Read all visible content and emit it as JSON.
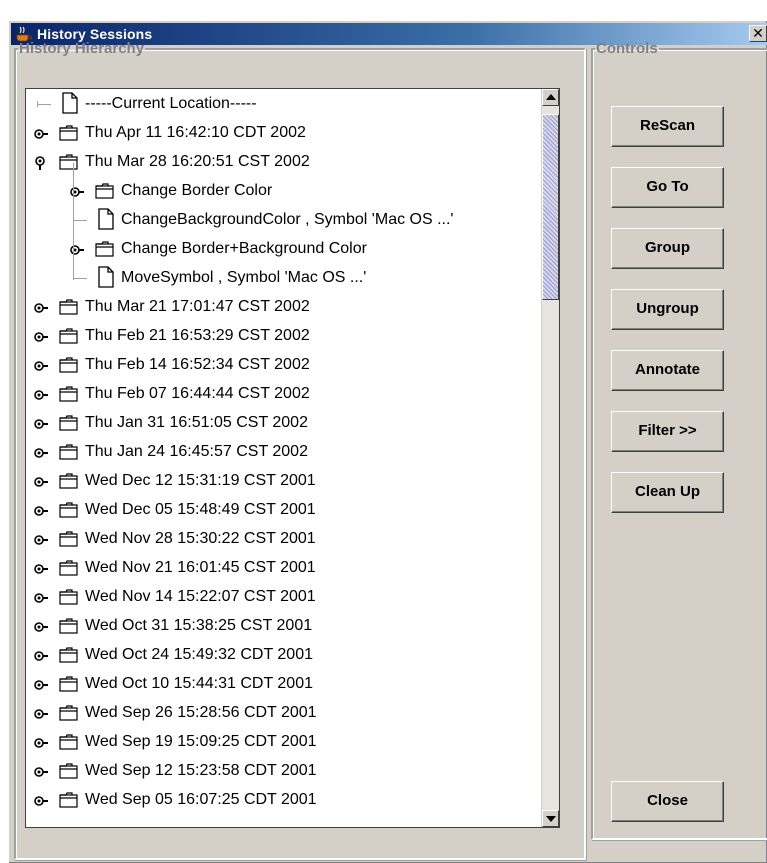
{
  "window": {
    "title": "History Sessions",
    "close_glyph": "✕"
  },
  "history": {
    "legend": "History Hierarchy",
    "items": [
      {
        "label": "-----Current Location-----",
        "icon": "document-icon",
        "expander": "none",
        "level": 0
      },
      {
        "label": "Thu Apr 11 16:42:10 CDT 2002",
        "icon": "folder-icon",
        "expander": "collapsed",
        "level": 0
      },
      {
        "label": "Thu Mar 28 16:20:51 CST 2002",
        "icon": "folder-icon",
        "expander": "expanded",
        "level": 0
      },
      {
        "label": "Change Border Color",
        "icon": "folder-icon",
        "expander": "collapsed",
        "level": 1
      },
      {
        "label": "ChangeBackgroundColor , Symbol 'Mac OS ...'",
        "icon": "document-icon",
        "expander": "none",
        "level": 1
      },
      {
        "label": "Change Border+Background Color",
        "icon": "folder-icon",
        "expander": "collapsed",
        "level": 1
      },
      {
        "label": "MoveSymbol , Symbol 'Mac OS ...'",
        "icon": "document-icon",
        "expander": "none",
        "level": 1
      },
      {
        "label": "Thu Mar 21 17:01:47 CST 2002",
        "icon": "folder-icon",
        "expander": "collapsed",
        "level": 0
      },
      {
        "label": "Thu Feb 21 16:53:29 CST 2002",
        "icon": "folder-icon",
        "expander": "collapsed",
        "level": 0
      },
      {
        "label": "Thu Feb 14 16:52:34 CST 2002",
        "icon": "folder-icon",
        "expander": "collapsed",
        "level": 0
      },
      {
        "label": "Thu Feb 07 16:44:44 CST 2002",
        "icon": "folder-icon",
        "expander": "collapsed",
        "level": 0
      },
      {
        "label": "Thu Jan 31 16:51:05 CST 2002",
        "icon": "folder-icon",
        "expander": "collapsed",
        "level": 0
      },
      {
        "label": "Thu Jan 24 16:45:57 CST 2002",
        "icon": "folder-icon",
        "expander": "collapsed",
        "level": 0
      },
      {
        "label": "Wed Dec 12 15:31:19 CST 2001",
        "icon": "folder-icon",
        "expander": "collapsed",
        "level": 0
      },
      {
        "label": "Wed Dec 05 15:48:49 CST 2001",
        "icon": "folder-icon",
        "expander": "collapsed",
        "level": 0
      },
      {
        "label": "Wed Nov 28 15:30:22 CST 2001",
        "icon": "folder-icon",
        "expander": "collapsed",
        "level": 0
      },
      {
        "label": "Wed Nov 21 16:01:45 CST 2001",
        "icon": "folder-icon",
        "expander": "collapsed",
        "level": 0
      },
      {
        "label": "Wed Nov 14 15:22:07 CST 2001",
        "icon": "folder-icon",
        "expander": "collapsed",
        "level": 0
      },
      {
        "label": "Wed Oct 31 15:38:25 CST 2001",
        "icon": "folder-icon",
        "expander": "collapsed",
        "level": 0
      },
      {
        "label": "Wed Oct 24 15:49:32 CDT 2001",
        "icon": "folder-icon",
        "expander": "collapsed",
        "level": 0
      },
      {
        "label": "Wed Oct 10 15:44:31 CDT 2001",
        "icon": "folder-icon",
        "expander": "collapsed",
        "level": 0
      },
      {
        "label": "Wed Sep 26 15:28:56 CDT 2001",
        "icon": "folder-icon",
        "expander": "collapsed",
        "level": 0
      },
      {
        "label": "Wed Sep 19 15:09:25 CDT 2001",
        "icon": "folder-icon",
        "expander": "collapsed",
        "level": 0
      },
      {
        "label": "Wed Sep 12 15:23:58 CDT 2001",
        "icon": "folder-icon",
        "expander": "collapsed",
        "level": 0
      },
      {
        "label": "Wed Sep 05 16:07:25 CDT 2001",
        "icon": "folder-icon",
        "expander": "collapsed",
        "level": 0
      }
    ],
    "scrollbar": {
      "thumb_fraction": 0.27
    }
  },
  "controls": {
    "legend": "Controls",
    "buttons": [
      {
        "label": "ReScan",
        "name": "rescan-button"
      },
      {
        "label": "Go To",
        "name": "go-to-button"
      },
      {
        "label": "Group",
        "name": "group-button"
      },
      {
        "label": "Ungroup",
        "name": "ungroup-button"
      },
      {
        "label": "Annotate",
        "name": "annotate-button"
      },
      {
        "label": "Filter >>",
        "name": "filter-button"
      },
      {
        "label": "Clean Up",
        "name": "clean-up-button"
      }
    ],
    "close_button": {
      "label": "Close"
    }
  },
  "colors": {
    "window_bg": "#d4d0c8",
    "titlebar_start": "#0a246a",
    "titlebar_end": "#a6caf0",
    "legend_text": "#808080",
    "tree_bg": "#ffffff"
  }
}
